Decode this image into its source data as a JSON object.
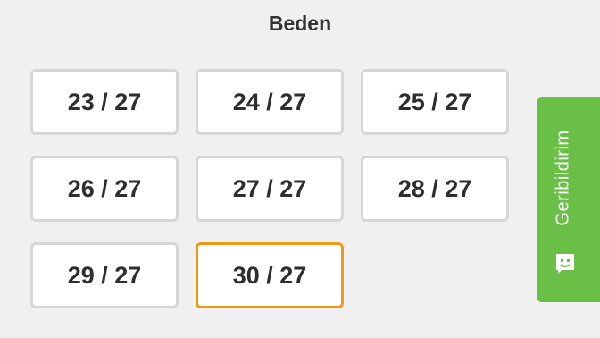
{
  "title": "Beden",
  "sizes": [
    {
      "label": "23 / 27"
    },
    {
      "label": "24 / 27"
    },
    {
      "label": "25 / 27"
    },
    {
      "label": "26 / 27"
    },
    {
      "label": "27 / 27"
    },
    {
      "label": "28 / 27"
    },
    {
      "label": "29 / 27"
    },
    {
      "label": "30 / 27"
    }
  ],
  "selected_size": "30 / 27",
  "feedback": {
    "label": "Geribildirim",
    "icon": "chat-face-icon",
    "color": "#6abf46"
  },
  "colors": {
    "selected_border": "#f09a14",
    "button_border": "#d6d6d6",
    "background": "#f0f0f0"
  }
}
